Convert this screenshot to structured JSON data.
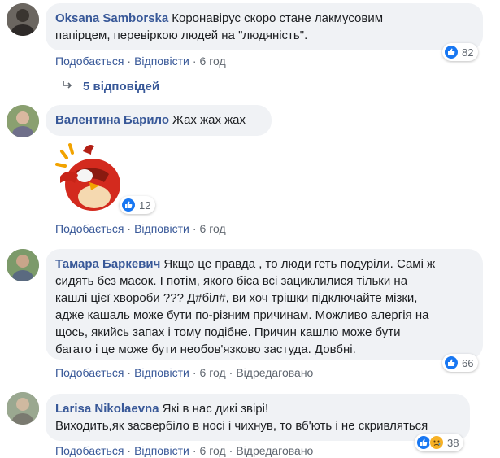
{
  "comments": [
    {
      "author": "Oksana Samborska",
      "line1": "Коронавірус скоро стане лакмусовим",
      "line2": "папірцем, перевіркою людей на \"людяність\".",
      "like": "Подобається",
      "reply": "Відповісти",
      "time": "6 год",
      "reactions": "82"
    },
    {
      "author": "Валентина Барило",
      "line1": "Жах жах жах",
      "like": "Подобається",
      "reply": "Відповісти",
      "time": "6 год",
      "reactions": "12"
    },
    {
      "author": "Тамара Баркевич",
      "line1": "Якщо це правда , то люди геть подуріли. Самі ж",
      "line2": "сидять без масок. І потім, якого біса всі зациклилися тільки на",
      "line3": "кашлі цієї хвороби ??? Д#біл#, ви хоч трішки підключайте мізки,",
      "line4": "адже кашаль може бути по-різним причинам. Можливо алергія на",
      "line5": "щось, якийсь запах і тому подібне. Причин кашлю може бути",
      "line6": "багато і це може бути необов'язково застуда. Довбні.",
      "like": "Подобається",
      "reply": "Відповісти",
      "time": "6 год",
      "edited": "Відредаговано",
      "reactions": "66"
    },
    {
      "author": "Larisa Nikolaevna",
      "line1": "Які в нас дикі звірі!",
      "line2": "Виходить,як засвербіло в носі і чихнув, то вб'ють і не скривляться",
      "like": "Подобається",
      "reply": "Відповісти",
      "time": "6 год",
      "edited": "Відредаговано",
      "reactions": "38"
    }
  ],
  "replies_label": "5 відповідей",
  "colors": {
    "link": "#385898",
    "bubble": "#f0f2f5",
    "like": "#1877f2",
    "meta": "#606770"
  }
}
